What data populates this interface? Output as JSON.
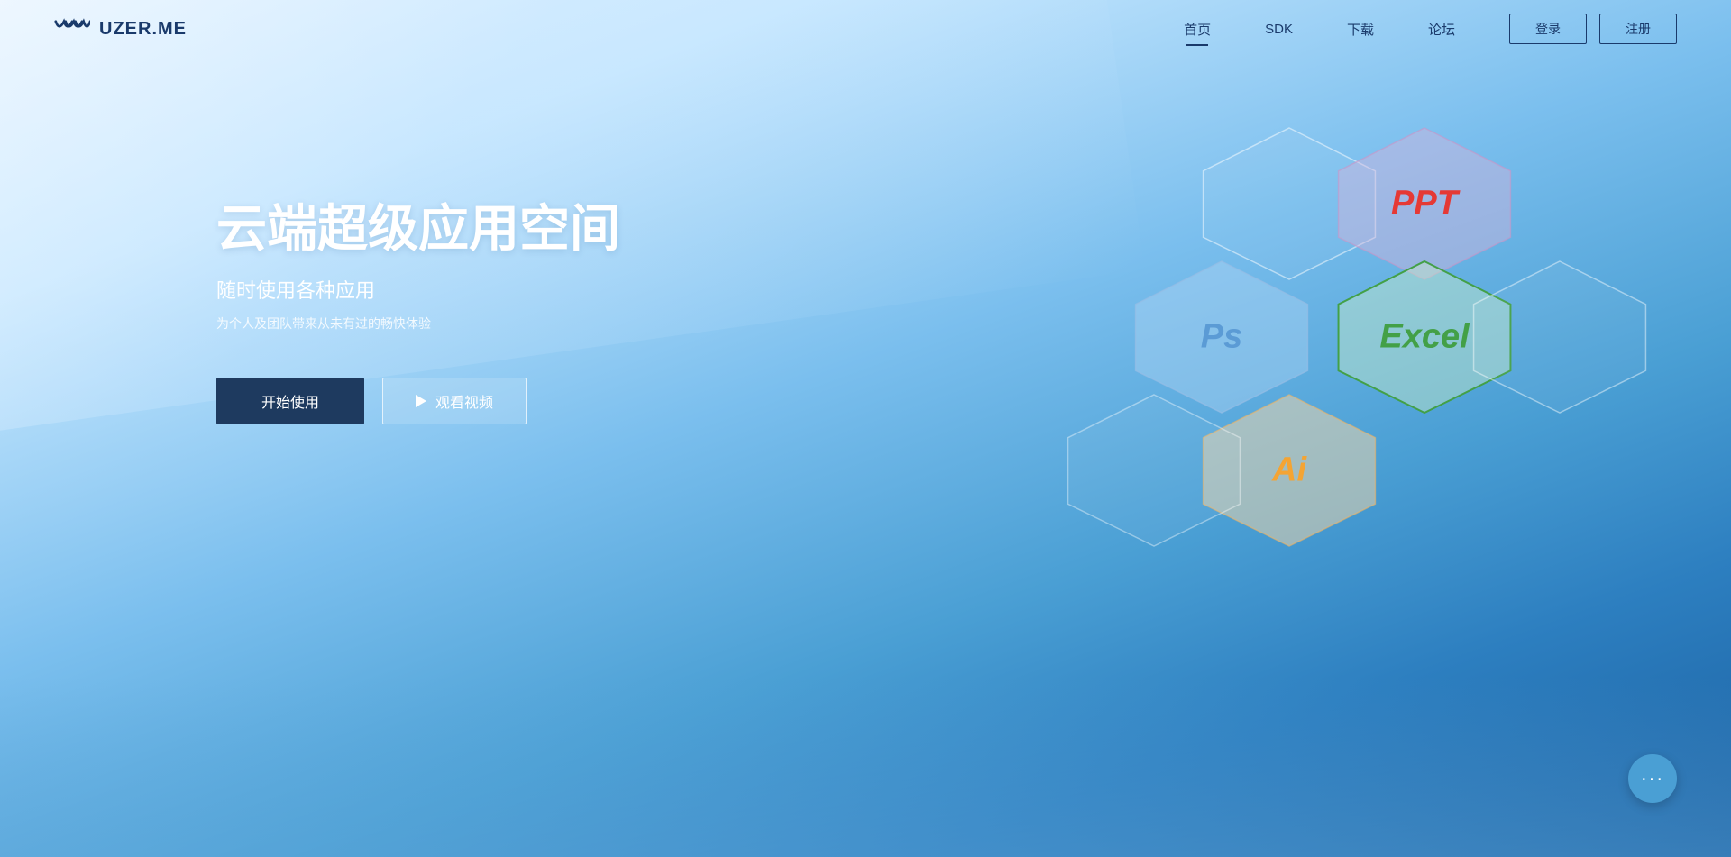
{
  "nav": {
    "logo_text": "UZER.ME",
    "links": [
      {
        "label": "首页",
        "active": true
      },
      {
        "label": "SDK",
        "active": false
      },
      {
        "label": "下载",
        "active": false
      },
      {
        "label": "论坛",
        "active": false
      }
    ],
    "btn_login": "登录",
    "btn_register": "注册"
  },
  "hero": {
    "title": "云端超级应用空间",
    "subtitle": "随时使用各种应用",
    "desc": "为个人及团队带来从未有过的畅快体验",
    "btn_start": "开始使用",
    "btn_video": "观看视频"
  },
  "hexagons": [
    {
      "id": "ppt",
      "label": "PPT",
      "color": "#e53935"
    },
    {
      "id": "ps",
      "label": "Ps",
      "color": "#5b9bd5"
    },
    {
      "id": "excel",
      "label": "Excel",
      "color": "#43a047"
    },
    {
      "id": "ai",
      "label": "Ai",
      "color": "#f4a433"
    }
  ],
  "colors": {
    "nav_bg": "rgba(255,255,255,0.0)",
    "btn_dark": "#1e3a5f",
    "accent_blue": "#4a9fd4",
    "ppt_color": "#e53935",
    "ps_color": "#5b9bd5",
    "excel_color": "#43a047",
    "ai_color": "#f4a433"
  }
}
